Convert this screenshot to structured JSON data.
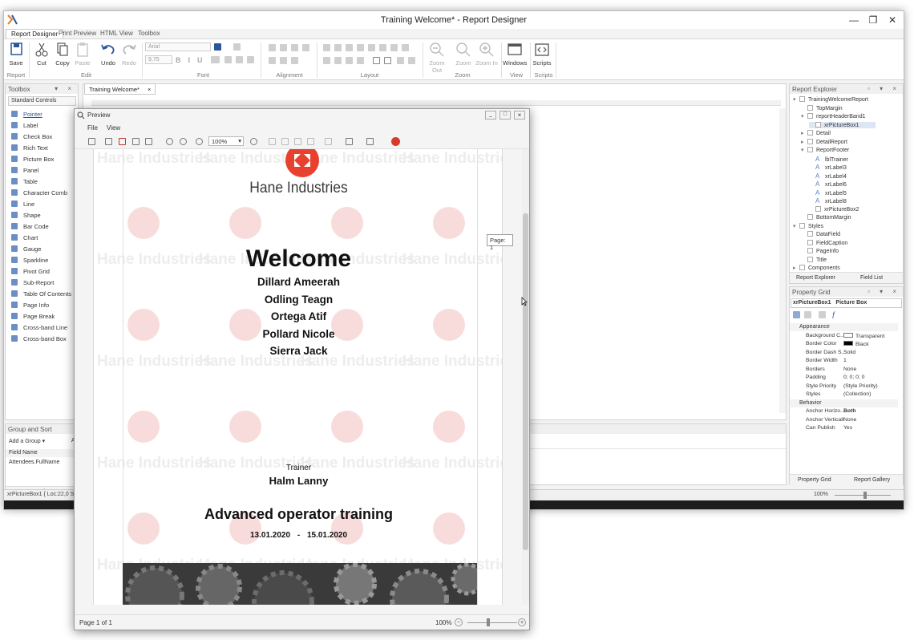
{
  "window": {
    "title": "Training Welcome* - Report Designer",
    "min_glyph": "—",
    "restore_glyph": "❐",
    "close_glyph": "✕"
  },
  "ribbon": {
    "tabs": [
      "Report Designer",
      "Print Preview",
      "HTML View",
      "Toolbox"
    ],
    "buttons": {
      "save": "Save",
      "cut": "Cut",
      "copy": "Copy",
      "paste": "Paste",
      "undo": "Undo",
      "redo": "Redo",
      "zoom_out": "Zoom Out",
      "zoom": "Zoom",
      "zoom_in": "Zoom In",
      "windows": "Windows",
      "scripts": "Scripts"
    },
    "font_name": "Arial",
    "font_size": "9,75",
    "groups": [
      "Report",
      "Edit",
      "Font",
      "Alignment",
      "Layout",
      "Zoom",
      "View",
      "Scripts"
    ]
  },
  "toolbox": {
    "title": "Toolbox",
    "category": "Standard Controls",
    "items": [
      "Pointer",
      "Label",
      "Check Box",
      "Rich Text",
      "Picture Box",
      "Panel",
      "Table",
      "Character Comb",
      "Line",
      "Shape",
      "Bar Code",
      "Chart",
      "Gauge",
      "Sparkline",
      "Pivot Grid",
      "Sub-Report",
      "Table Of Contents",
      "Page Info",
      "Page Break",
      "Cross-band Line",
      "Cross-band Box"
    ]
  },
  "document_tab": "Training Welcome*",
  "report_explorer": {
    "title": "Report Explorer",
    "tree": [
      {
        "label": "TrainingWelcomeReport",
        "indent": 0
      },
      {
        "label": "TopMargin",
        "indent": 1
      },
      {
        "label": "reportHeaderBand1",
        "indent": 1
      },
      {
        "label": "xrPictureBox1",
        "indent": 2
      },
      {
        "label": "Detail",
        "indent": 1
      },
      {
        "label": "DetailReport",
        "indent": 1
      },
      {
        "label": "ReportFooter",
        "indent": 1
      },
      {
        "label": "lblTrainer",
        "indent": 2
      },
      {
        "label": "xrLabel3",
        "indent": 2
      },
      {
        "label": "xrLabel4",
        "indent": 2
      },
      {
        "label": "xrLabel6",
        "indent": 2
      },
      {
        "label": "xrLabel5",
        "indent": 2
      },
      {
        "label": "xrLabel8",
        "indent": 2
      },
      {
        "label": "xrPictureBox2",
        "indent": 2
      },
      {
        "label": "BottomMargin",
        "indent": 1
      },
      {
        "label": "Styles",
        "indent": 0
      },
      {
        "label": "DataField",
        "indent": 1
      },
      {
        "label": "FieldCaption",
        "indent": 1
      },
      {
        "label": "PageInfo",
        "indent": 1
      },
      {
        "label": "Title",
        "indent": 1
      },
      {
        "label": "Components",
        "indent": 0
      }
    ],
    "tabs": [
      "Report Explorer",
      "Field List"
    ]
  },
  "property_grid": {
    "title": "Property Grid",
    "selected": "xrPictureBox1",
    "selected_type": "Picture Box",
    "categories": {
      "appearance": "Appearance",
      "behavior": "Behavior"
    },
    "appearance_rows": [
      {
        "name": "Background C...",
        "value": "Transparent"
      },
      {
        "name": "Border Color",
        "value": "Black"
      },
      {
        "name": "Border Dash S...",
        "value": "Solid"
      },
      {
        "name": "Border Width",
        "value": "1"
      },
      {
        "name": "Borders",
        "value": "None"
      },
      {
        "name": "Padding",
        "value": "0; 0; 0; 0"
      },
      {
        "name": "Style Priority",
        "value": "(Style Priority)"
      },
      {
        "name": "Styles",
        "value": "(Collection)"
      }
    ],
    "behavior_rows": [
      {
        "name": "Anchor Horizo...",
        "value": "Both"
      },
      {
        "name": "Anchor Verticall",
        "value": "None"
      },
      {
        "name": "Can Publish",
        "value": "Yes"
      }
    ],
    "tabs": [
      "Property Grid",
      "Report Gallery"
    ]
  },
  "group_sort": {
    "title": "Group and Sort",
    "add_group": "Add a Group",
    "add_sort_abbrev": "A",
    "column_header": "Field Name",
    "row": "Attendees.FullName",
    "tab": "Group and Sort"
  },
  "status_bar": {
    "left": "xrPictureBox1 { Loc:22,0 Size",
    "zoom": "100%"
  },
  "preview": {
    "title": "Preview",
    "menu": [
      "File",
      "View"
    ],
    "zoom": "100%",
    "page_tooltip": "Page: 1",
    "status_page": "Page 1 of 1",
    "status_zoom": "100%",
    "report": {
      "company": "Hane Industries",
      "watermark": "Hane Industries",
      "heading": "Welcome",
      "attendees": [
        "Dillard Ameerah",
        "Odling Teagn",
        "Ortega Atif",
        "Pollard Nicole",
        "Sierra Jack"
      ],
      "trainer_label": "Trainer",
      "trainer_name": "Halm Lanny",
      "course": "Advanced operator training",
      "date_from": "13.01.2020",
      "date_sep": "-",
      "date_to": "15.01.2020"
    }
  },
  "colors": {
    "logo_red": "#e8412f",
    "accent_blue": "#2b579a"
  }
}
